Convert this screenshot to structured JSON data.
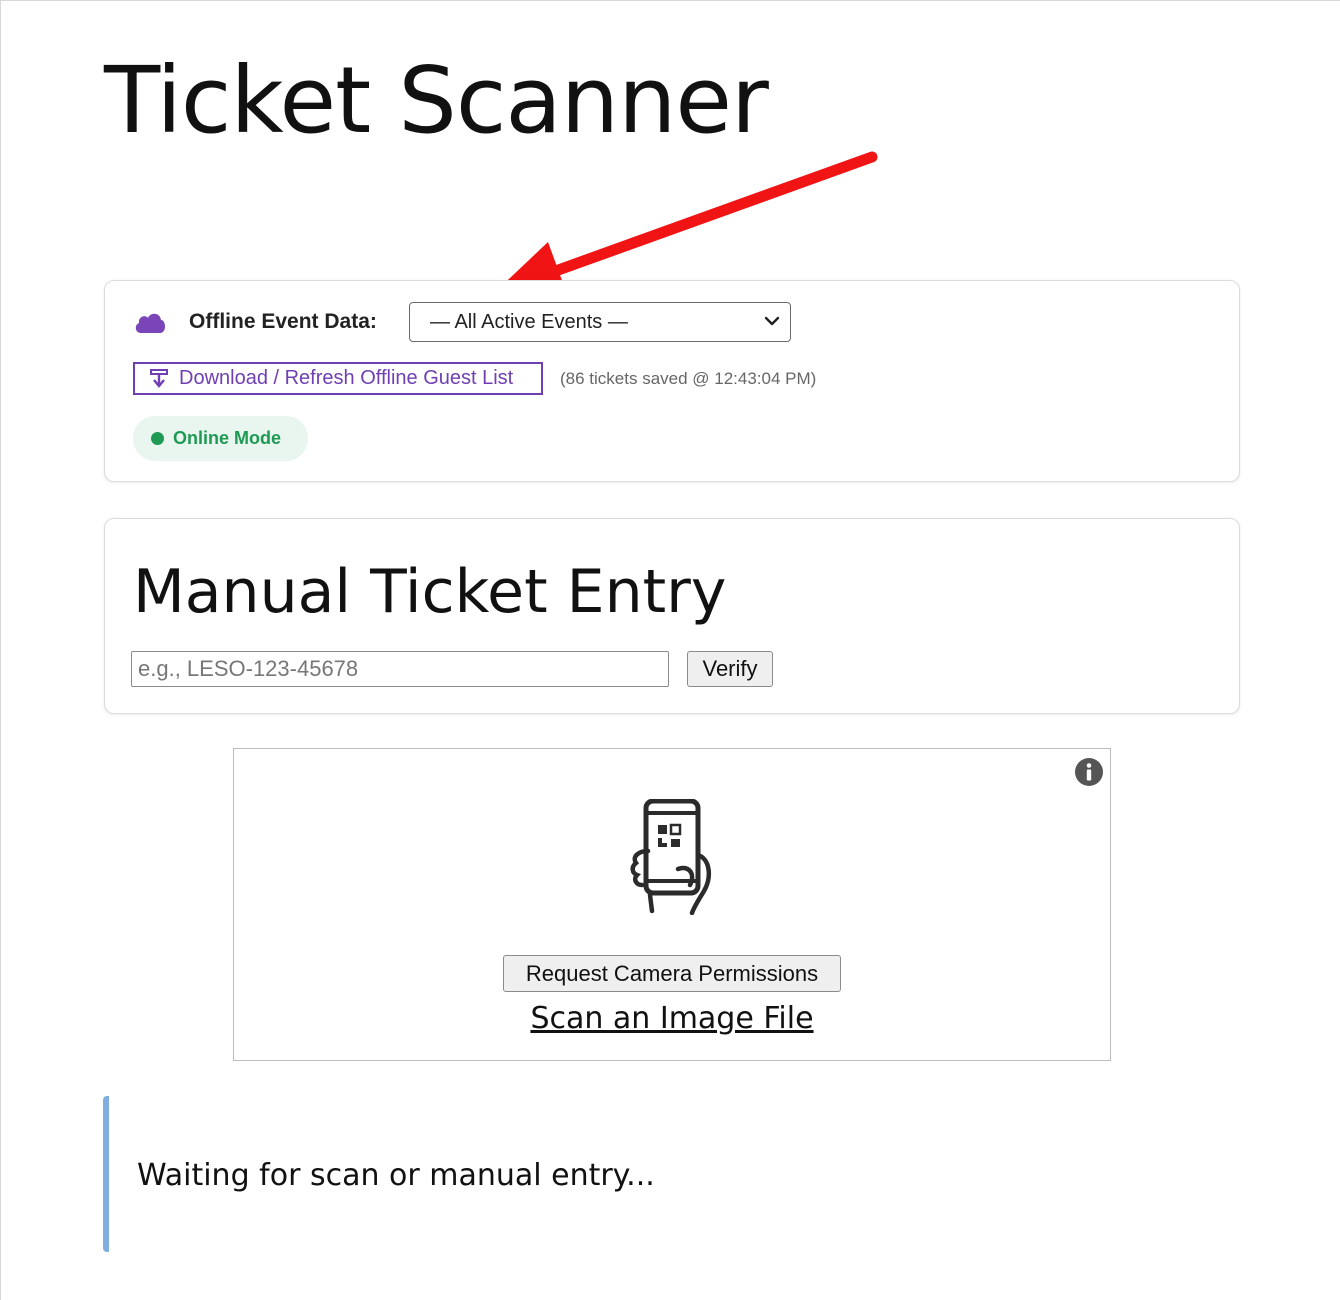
{
  "page": {
    "title": "Ticket Scanner"
  },
  "offline": {
    "label": "Offline Event Data:",
    "selected_event": "— All Active Events —",
    "download_label": "Download / Refresh Offline Guest List",
    "saved_info": "(86 tickets saved @ 12:43:04 PM)",
    "status": "Online Mode",
    "status_color": "#1f9a55",
    "accent_color": "#6f3fb3"
  },
  "manual": {
    "title": "Manual Ticket Entry",
    "placeholder": "e.g., LESO-123-45678",
    "verify_label": "Verify"
  },
  "scanner": {
    "camera_button": "Request Camera Permissions",
    "scan_file_link": "Scan an Image File"
  },
  "result": {
    "status_text": "Waiting for scan or manual entry..."
  },
  "icons": {
    "cloud": "cloud-icon",
    "download": "download-icon",
    "info": "info-icon",
    "phone": "phone-qr-icon",
    "annotation": "red-arrow"
  }
}
